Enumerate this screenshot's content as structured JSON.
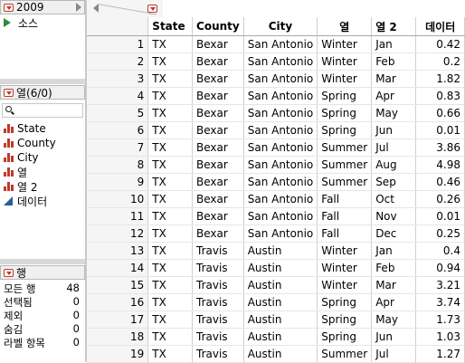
{
  "table_panel": {
    "name": "2009",
    "script": "소스"
  },
  "columns_panel": {
    "header": "열(6/0)",
    "items": [
      {
        "label": "State",
        "icon": "bar-chart-icon"
      },
      {
        "label": "County",
        "icon": "bar-chart-icon"
      },
      {
        "label": "City",
        "icon": "bar-chart-icon"
      },
      {
        "label": "열",
        "icon": "bar-chart-icon"
      },
      {
        "label": "열 2",
        "icon": "bar-chart-icon"
      },
      {
        "label": "데이터",
        "icon": "continuous-triangle-icon"
      }
    ]
  },
  "rows_panel": {
    "header": "행",
    "stats": [
      {
        "label": "모든 행",
        "value": "48"
      },
      {
        "label": "선택됨",
        "value": "0"
      },
      {
        "label": "제외",
        "value": "0"
      },
      {
        "label": "숨김",
        "value": "0"
      },
      {
        "label": "라벨 항목",
        "value": "0"
      }
    ]
  },
  "grid": {
    "headers": [
      "State",
      "County",
      "City",
      "열",
      "열 2",
      "데이터"
    ],
    "rows": [
      [
        "1",
        "TX",
        "Bexar",
        "San Antonio",
        "Winter",
        "Jan",
        "0.42"
      ],
      [
        "2",
        "TX",
        "Bexar",
        "San Antonio",
        "Winter",
        "Feb",
        "0.2"
      ],
      [
        "3",
        "TX",
        "Bexar",
        "San Antonio",
        "Winter",
        "Mar",
        "1.82"
      ],
      [
        "4",
        "TX",
        "Bexar",
        "San Antonio",
        "Spring",
        "Apr",
        "0.83"
      ],
      [
        "5",
        "TX",
        "Bexar",
        "San Antonio",
        "Spring",
        "May",
        "0.66"
      ],
      [
        "6",
        "TX",
        "Bexar",
        "San Antonio",
        "Spring",
        "Jun",
        "0.01"
      ],
      [
        "7",
        "TX",
        "Bexar",
        "San Antonio",
        "Summer",
        "Jul",
        "3.86"
      ],
      [
        "8",
        "TX",
        "Bexar",
        "San Antonio",
        "Summer",
        "Aug",
        "4.98"
      ],
      [
        "9",
        "TX",
        "Bexar",
        "San Antonio",
        "Summer",
        "Sep",
        "0.46"
      ],
      [
        "10",
        "TX",
        "Bexar",
        "San Antonio",
        "Fall",
        "Oct",
        "0.26"
      ],
      [
        "11",
        "TX",
        "Bexar",
        "San Antonio",
        "Fall",
        "Nov",
        "0.01"
      ],
      [
        "12",
        "TX",
        "Bexar",
        "San Antonio",
        "Fall",
        "Dec",
        "0.25"
      ],
      [
        "13",
        "TX",
        "Travis",
        "Austin",
        "Winter",
        "Jan",
        "0.4"
      ],
      [
        "14",
        "TX",
        "Travis",
        "Austin",
        "Winter",
        "Feb",
        "0.94"
      ],
      [
        "15",
        "TX",
        "Travis",
        "Austin",
        "Winter",
        "Mar",
        "3.21"
      ],
      [
        "16",
        "TX",
        "Travis",
        "Austin",
        "Spring",
        "Apr",
        "3.74"
      ],
      [
        "17",
        "TX",
        "Travis",
        "Austin",
        "Spring",
        "May",
        "1.73"
      ],
      [
        "18",
        "TX",
        "Travis",
        "Austin",
        "Spring",
        "Jun",
        "1.03"
      ],
      [
        "19",
        "TX",
        "Travis",
        "Austin",
        "Summer",
        "Jul",
        "1.27"
      ]
    ]
  },
  "colors": {
    "accent_red": "#c0392b",
    "continuous_blue": "#2c5aa0",
    "script_green": "#2e8b3a"
  }
}
